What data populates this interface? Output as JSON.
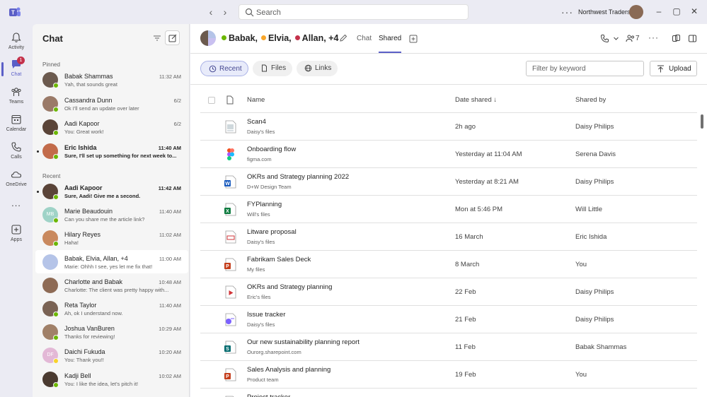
{
  "titlebar": {
    "search_placeholder": "Search",
    "org_name": "Northwest Traders"
  },
  "rail": {
    "items": [
      {
        "label": "Activity",
        "icon": "bell-icon"
      },
      {
        "label": "Chat",
        "icon": "chat-icon",
        "badge": "1"
      },
      {
        "label": "Teams",
        "icon": "teams-icon"
      },
      {
        "label": "Calendar",
        "icon": "calendar-icon"
      },
      {
        "label": "Calls",
        "icon": "phone-icon"
      },
      {
        "label": "OneDrive",
        "icon": "cloud-icon"
      },
      {
        "label": "Apps",
        "icon": "apps-icon"
      }
    ],
    "more": "..."
  },
  "chatlist": {
    "title": "Chat",
    "pinned_label": "Pinned",
    "recent_label": "Recent",
    "pinned": [
      {
        "name": "Babak Shammas",
        "preview": "Yah, that sounds great",
        "time": "11:32 AM",
        "presence": "available",
        "color": "#6b5a4e"
      },
      {
        "name": "Cassandra Dunn",
        "preview": "Ok I'll send an update over later",
        "time": "6/2",
        "presence": "available",
        "color": "#9a7a68"
      },
      {
        "name": "Aadi Kapoor",
        "preview": "You: Great work!",
        "time": "6/2",
        "presence": "available",
        "color": "#5a4438"
      },
      {
        "name": "Eric Ishida",
        "preview": "Sure, I'll set up something for next week to...",
        "time": "11:40 AM",
        "presence": "available",
        "color": "#c26b4a",
        "unread": true
      }
    ],
    "recent": [
      {
        "name": "Aadi Kapoor",
        "preview": "Sure, Aadi! Give me a second.",
        "time": "11:42 AM",
        "presence": "available",
        "color": "#5a4438",
        "unread": true
      },
      {
        "name": "Marie Beaudouin",
        "preview": "Can you share me the article link?",
        "time": "11:40 AM",
        "presence": "available",
        "color": "#9fd3c7",
        "initials": "MB"
      },
      {
        "name": "Hilary Reyes",
        "preview": "Haha!",
        "time": "11:02 AM",
        "presence": "available",
        "color": "#c9895e"
      },
      {
        "name": "Babak, Elvia, Allan, +4",
        "preview": "Marie: Ohhh I see, yes let me fix that!",
        "time": "11:00 AM",
        "presence": "group",
        "color": "#b5c4e8",
        "selected": true
      },
      {
        "name": "Charlotte and Babak",
        "preview": "Charlotte: The client was pretty happy with...",
        "time": "10:48 AM",
        "presence": "none",
        "color": "#8e6b55"
      },
      {
        "name": "Reta Taylor",
        "preview": "Ah, ok I understand now.",
        "time": "11:40 AM",
        "presence": "available",
        "color": "#7a6354"
      },
      {
        "name": "Joshua VanBuren",
        "preview": "Thanks for reviewing!",
        "time": "10:29 AM",
        "presence": "available",
        "color": "#a08068"
      },
      {
        "name": "Daichi Fukuda",
        "preview": "You: Thank you!!",
        "time": "10:20 AM",
        "presence": "away",
        "color": "#e3b8d6",
        "initials": "DF"
      },
      {
        "name": "Kadji Bell",
        "preview": "You: I like the idea, let's pitch it!",
        "time": "10:02 AM",
        "presence": "available",
        "color": "#4a3a30"
      }
    ]
  },
  "header": {
    "names": [
      {
        "name": "Babak,",
        "status_color": "#6bb700"
      },
      {
        "name": "Elvia,",
        "status_color": "#f8a62a"
      },
      {
        "name": "Allan, +4",
        "status_color": "#c4314b"
      }
    ],
    "tabs": [
      "Chat",
      "Shared"
    ],
    "active_tab": "Shared",
    "people_count": "7"
  },
  "toolbar": {
    "pills": [
      {
        "label": "Recent",
        "icon": "clock-icon",
        "active": true
      },
      {
        "label": "Files",
        "icon": "file-icon",
        "active": false
      },
      {
        "label": "Links",
        "icon": "link-icon",
        "active": false
      }
    ],
    "filter_placeholder": "Filter by keyword",
    "upload_label": "Upload"
  },
  "table": {
    "columns": {
      "name": "Name",
      "date": "Date shared ↓",
      "by": "Shared by"
    },
    "rows": [
      {
        "name": "Scan4",
        "location": "Daisy's files",
        "date": "2h ago",
        "by": "Daisy Philips",
        "type": "image"
      },
      {
        "name": "Onboarding flow",
        "location": "figma.com",
        "date": "Yesterday at 11:04 AM",
        "by": "Serena Davis",
        "type": "figma"
      },
      {
        "name": "OKRs and Strategy planning 2022",
        "location": "D+W Design Team",
        "date": "Yesterday at 8:21 AM",
        "by": "Daisy Philips",
        "type": "word"
      },
      {
        "name": "FYPlanning",
        "location": "Will's files",
        "date": "Mon at 5:46 PM",
        "by": "Will Little",
        "type": "excel"
      },
      {
        "name": "Litware proposal",
        "location": "Daisy's files",
        "date": "16 March",
        "by": "Eric Ishida",
        "type": "pdf"
      },
      {
        "name": "Fabrikam Sales Deck",
        "location": "My files",
        "date": "8 March",
        "by": "You",
        "type": "powerpoint"
      },
      {
        "name": "OKRs and Strategy planning",
        "location": "Eric's files",
        "date": "22 Feb",
        "by": "Daisy Philips",
        "type": "video"
      },
      {
        "name": "Issue tracker",
        "location": "Daisy's files",
        "date": "21 Feb",
        "by": "Daisy Philips",
        "type": "loop"
      },
      {
        "name": "Our new sustainability planning report",
        "location": "Ourorg.sharepoint.com",
        "date": "11 Feb",
        "by": "Babak Shammas",
        "type": "sharepoint"
      },
      {
        "name": "Sales Analysis and planning",
        "location": "Product team",
        "date": "19 Feb",
        "by": "You",
        "type": "powerpoint"
      },
      {
        "name": "Project tracker",
        "location": "",
        "date": "",
        "by": "",
        "type": "doc"
      }
    ]
  },
  "colors": {
    "accent": "#5b5fc7",
    "available": "#6bb700",
    "away": "#f8d22a",
    "word": "#185abd",
    "excel": "#107c41",
    "powerpoint": "#c43e1c",
    "pdf": "#d13438"
  }
}
